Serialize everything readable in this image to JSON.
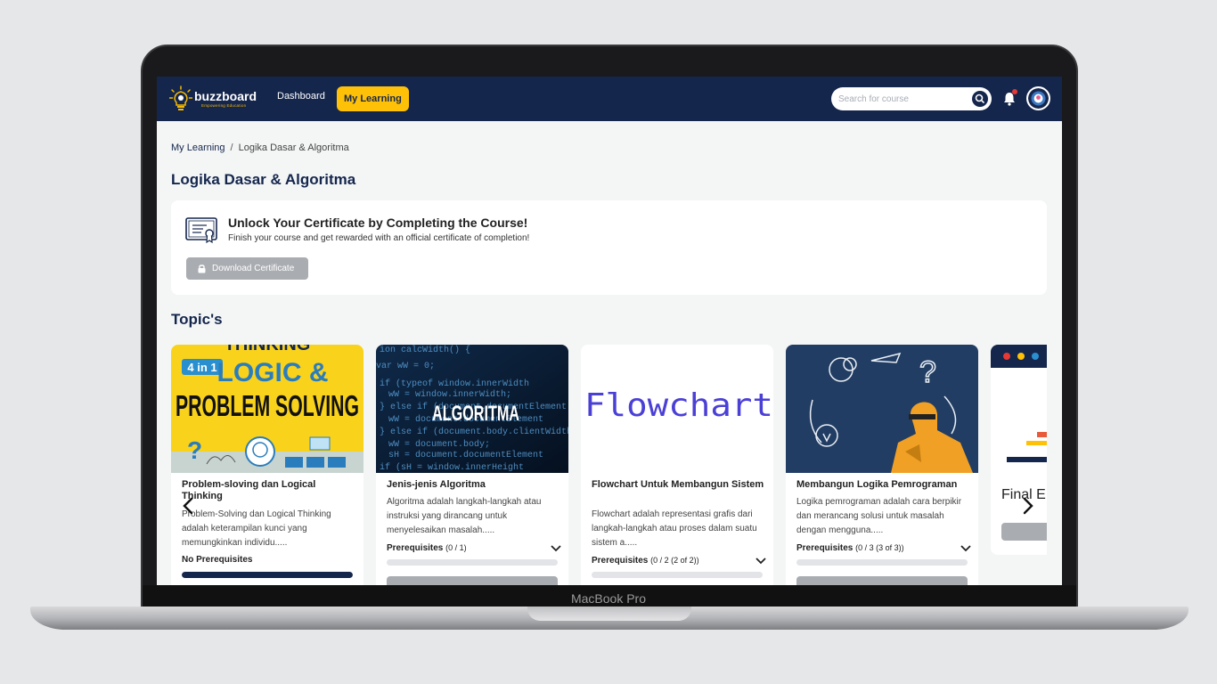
{
  "device": {
    "label": "MacBook Pro"
  },
  "navbar": {
    "brand": "buzzboard",
    "tagline": "Empowering Education",
    "links": [
      "Dashboard",
      "My Learning"
    ],
    "active": "My Learning",
    "search_placeholder": "Search for course"
  },
  "breadcrumb": {
    "parent": "My Learning",
    "separator": "/",
    "current": "Logika Dasar & Algoritma"
  },
  "page_title": "Logika Dasar & Algoritma",
  "certificate": {
    "title": "Unlock Your Certificate by Completing the Course!",
    "subtitle": "Finish your course and get rewarded with an official certificate of completion!",
    "button": "Download Certificate"
  },
  "topics_title": "Topic's",
  "cards": [
    {
      "title": "Problem-sloving dan Logical Thinking",
      "desc": "Problem-Solving dan Logical Thinking adalah keterampilan kunci yang memungkinkan individu.....",
      "prereq_label": "No Prerequisites",
      "prereq_count": "",
      "progress": 1.0,
      "img_text": [
        "THINKING",
        "4 in 1",
        "LOGIC &",
        "PROBLEM SOLVING"
      ]
    },
    {
      "title": "Jenis-jenis Algoritma",
      "desc": "Algoritma adalah langkah-langkah atau instruksi yang dirancang untuk menyelesaikan masalah.....",
      "prereq_label": "Prerequisites",
      "prereq_count": "(0 / 1)",
      "progress": 0,
      "img_text": [
        "ALGORITMA"
      ]
    },
    {
      "title": "Flowchart Untuk Membangun Sistem",
      "desc": "Flowchart adalah representasi grafis dari langkah-langkah atau proses dalam suatu sistem a.....",
      "prereq_label": "Prerequisites",
      "prereq_count": "(0 / 2 (2 of 2))",
      "progress": 0,
      "img_text": [
        "Flowchart"
      ]
    },
    {
      "title": "Membangun Logika Pemrograman",
      "desc": "Logika pemrograman adalah cara berpikir dan merancang solusi untuk masalah dengan mengguna.....",
      "prereq_label": "Prerequisites",
      "prereq_count": "(0 / 3 (3 of 3))",
      "progress": 0,
      "img_text": []
    },
    {
      "title": "Final E",
      "desc": "",
      "prereq_label": "",
      "prereq_count": "",
      "progress": 0,
      "img_text": []
    }
  ],
  "colors": {
    "navy": "#15264d",
    "accent": "#ffc107",
    "disabled": "#a9acb1"
  },
  "icons": [
    "lightbulb-icon",
    "search-icon",
    "bell-icon",
    "avatar",
    "certificate-icon",
    "lock-icon",
    "chevron-down-icon",
    "chevron-left-icon",
    "chevron-right-icon"
  ]
}
